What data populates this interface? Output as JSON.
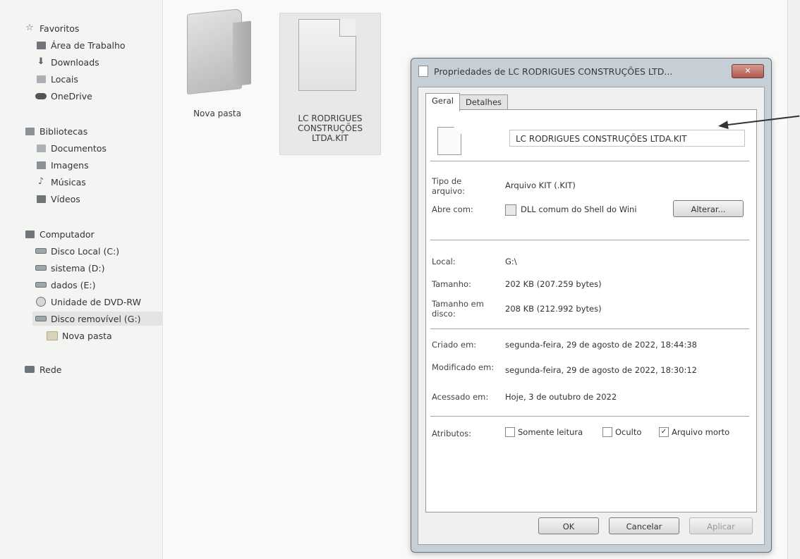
{
  "nav": {
    "favorites": "Favoritos",
    "desktop": "Área de Trabalho",
    "downloads": "Downloads",
    "places": "Locais",
    "onedrive": "OneDrive",
    "libraries": "Bibliotecas",
    "documents": "Documentos",
    "images": "Imagens",
    "music": "Músicas",
    "videos": "Vídeos",
    "computer": "Computador",
    "local_disk": "Disco Local (C:)",
    "sistema": "sistema (D:)",
    "dados": "dados (E:)",
    "dvd": "Unidade de DVD-RW",
    "removable": "Disco removível (G:)",
    "new_folder": "Nova pasta",
    "network": "Rede"
  },
  "files": [
    {
      "label": "Nova pasta",
      "type": "folder"
    },
    {
      "label_lines": [
        "LC RODRIGUES",
        "CONSTRUÇÕES",
        "LTDA.KIT"
      ],
      "type": "file"
    }
  ],
  "dialog": {
    "title": "Propriedades de LC RODRIGUES CONSTRUÇÕES LTD...",
    "close_label": "✕",
    "tabs": [
      "Geral",
      "Detalhes"
    ],
    "filename": "LC RODRIGUES CONSTRUÇÕES LTDA.KIT",
    "file_type_label": "Tipo de arquivo:",
    "file_type_value": "Arquivo KIT (.KIT)",
    "opens_with_label": "Abre com:",
    "opens_with_value": "DLL comum do Shell do Wini",
    "change_button": "Alterar...",
    "location_label": "Local:",
    "location_value": "G:\\",
    "size_label": "Tamanho:",
    "size_value": "202 KB (207.259 bytes)",
    "size_on_disk_label": "Tamanho em disco:",
    "size_on_disk_value": "208 KB (212.992 bytes)",
    "created_label": "Criado em:",
    "created_value": "segunda-feira, 29 de agosto de 2022, 18:44:38",
    "modified_label": "Modificado em:",
    "modified_value": "segunda-feira, 29 de agosto de 2022, 18:30:12",
    "accessed_label": "Acessado em:",
    "accessed_value": "Hoje, 3 de outubro de 2022",
    "attributes_label": "Atributos:",
    "attr_readonly": "Somente leitura",
    "attr_hidden": "Oculto",
    "attr_archive": "Arquivo morto",
    "ok_button": "OK",
    "cancel_button": "Cancelar",
    "apply_button": "Aplicar"
  }
}
